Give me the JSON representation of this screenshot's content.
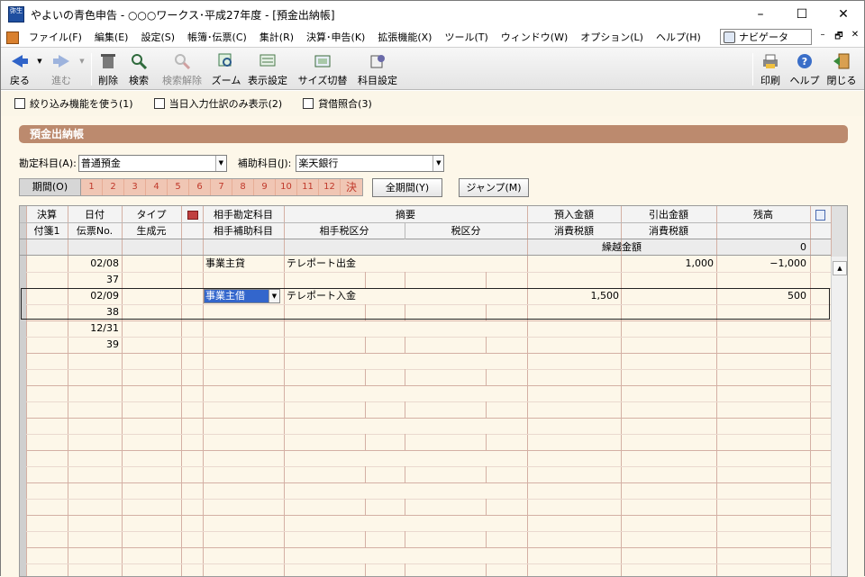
{
  "window": {
    "app_icon_text": "弥生",
    "title": "やよいの青色申告 - ○○○ワークス･平成27年度 - [預金出納帳]",
    "minimize": "–",
    "maximize": "☐",
    "close": "✕"
  },
  "menu": {
    "items": [
      "ファイル(F)",
      "編集(E)",
      "設定(S)",
      "帳簿･伝票(C)",
      "集計(R)",
      "決算･申告(K)",
      "拡張機能(X)",
      "ツール(T)",
      "ウィンドウ(W)",
      "オプション(L)",
      "ヘルプ(H)"
    ],
    "navigator": "ナビゲータ",
    "mdi_min": "–",
    "mdi_restore": "🗗",
    "mdi_close": "✕"
  },
  "toolbar": {
    "back": "戻る",
    "forward": "進む",
    "delete": "削除",
    "search": "検索",
    "clear_search": "検索解除",
    "zoom": "ズーム",
    "display_settings": "表示設定",
    "size_switch": "サイズ切替",
    "account_settings": "科目設定",
    "print": "印刷",
    "help": "ヘルプ",
    "close": "閉じる"
  },
  "filters": {
    "narrow": "絞り込み機能を使う(1)",
    "today_only": "当日入力仕訳のみ表示(2)",
    "balance_check": "貸借照合(3)"
  },
  "panel": {
    "title": "預金出納帳",
    "account_label": "勘定科目(A):",
    "account_value": "普通預金",
    "sub_account_label": "補助科目(J):",
    "sub_account_value": "楽天銀行",
    "period_label": "期間(O)",
    "months": [
      "1",
      "2",
      "3",
      "4",
      "5",
      "6",
      "7",
      "8",
      "9",
      "10",
      "11",
      "12",
      "決"
    ],
    "all_period_button": "全期間(Y)",
    "jump_button": "ジャンプ(M)"
  },
  "grid": {
    "header_row1": [
      "決算",
      "日付",
      "タイプ",
      "相手勘定科目",
      "摘要",
      "預入金額",
      "引出金額",
      "残高"
    ],
    "header_row2": [
      "付箋1",
      "伝票No.",
      "生成元",
      "相手補助科目",
      "相手税区分",
      "税区分",
      "消費税額",
      "消費税額"
    ],
    "carry_label": "繰越金額",
    "carry_value": "0",
    "rows": [
      {
        "date": "02/08",
        "slip": "37",
        "account": "事業主貸",
        "memo": "テレポート出金",
        "deposit": "",
        "withdrawal": "1,000",
        "balance": "−1,000"
      },
      {
        "date": "02/09",
        "slip": "38",
        "account": "事業主借",
        "memo": "テレポート入金",
        "deposit": "1,500",
        "withdrawal": "",
        "balance": "500"
      },
      {
        "date": "12/31",
        "slip": "39",
        "account": "",
        "memo": "",
        "deposit": "",
        "withdrawal": "",
        "balance": ""
      }
    ]
  },
  "colors": {
    "panel_title": "#bc8a6e",
    "background": "#fdf7e9",
    "period_bg": "#f0c6b4",
    "period_text": "#c0392b",
    "grid_line": "#d4b0a4",
    "header_bg": "#f3f3f3",
    "selection": "#3366cc"
  }
}
